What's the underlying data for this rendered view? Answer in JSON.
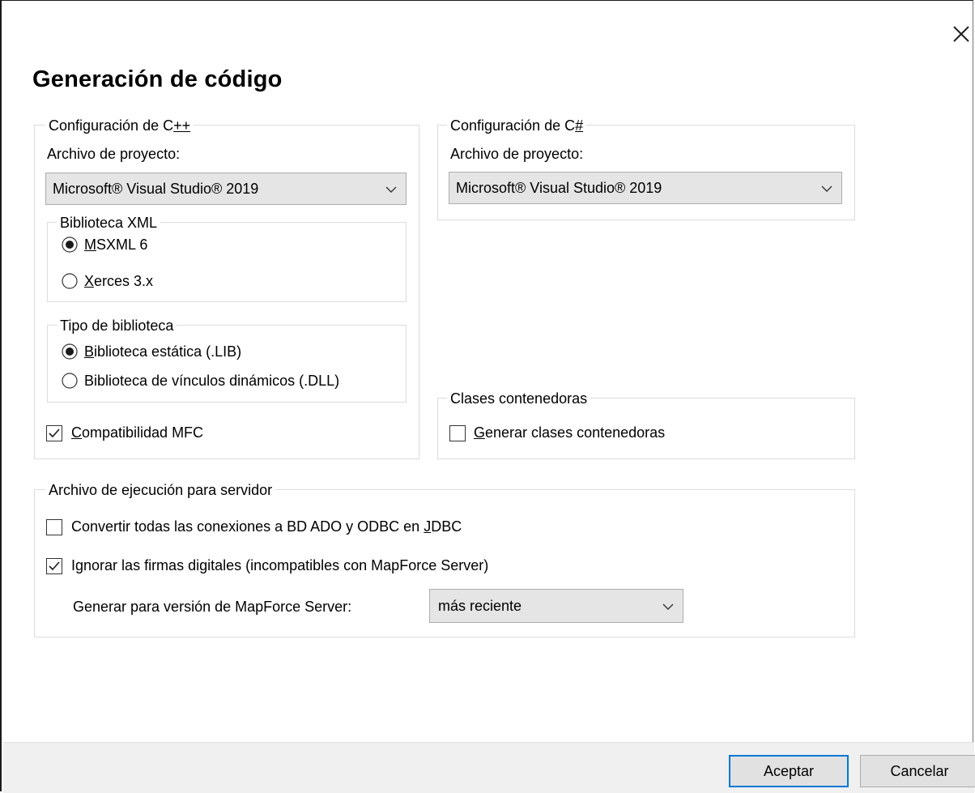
{
  "dialog": {
    "title": "Generación de código",
    "close_glyph": "✕"
  },
  "cpp": {
    "legend": "Configuración de C++",
    "project_label": "Archivo de proyecto:",
    "project_value": "Microsoft® Visual Studio® 2019",
    "xml_lib": {
      "legend": "Biblioteca XML",
      "options": [
        {
          "label": "MSXML 6",
          "selected": true
        },
        {
          "label": "Xerces 3.x",
          "selected": false
        }
      ]
    },
    "lib_type": {
      "legend": "Tipo de biblioteca",
      "options": [
        {
          "label": "Biblioteca estática (.LIB)",
          "selected": true
        },
        {
          "label": "Biblioteca de vínculos dinámicos (.DLL)",
          "selected": false
        }
      ]
    },
    "mfc": {
      "label": "Compatibilidad MFC",
      "checked": true
    }
  },
  "csharp": {
    "legend": "Configuración de C#",
    "project_label": "Archivo de proyecto:",
    "project_value": "Microsoft® Visual Studio® 2019"
  },
  "wrapper": {
    "legend": "Clases contenedoras",
    "generate": {
      "label": "Generar clases contenedoras",
      "checked": false
    }
  },
  "server": {
    "legend": "Archivo de ejecución para servidor",
    "convert": {
      "label": "Convertir todas las conexiones a BD ADO y ODBC en JDBC",
      "checked": false
    },
    "ignore_sig": {
      "label": "Ignorar las firmas digitales (incompatibles con MapForce Server)",
      "checked": true
    },
    "version_label": "Generar para versión de MapForce Server:",
    "version_value": "más reciente"
  },
  "footer": {
    "ok": "Aceptar",
    "cancel": "Cancelar"
  },
  "icons": {
    "close": "close-icon",
    "chevron": "chevron-down-icon",
    "check": "checkmark-icon",
    "accent": "#0078d7"
  }
}
